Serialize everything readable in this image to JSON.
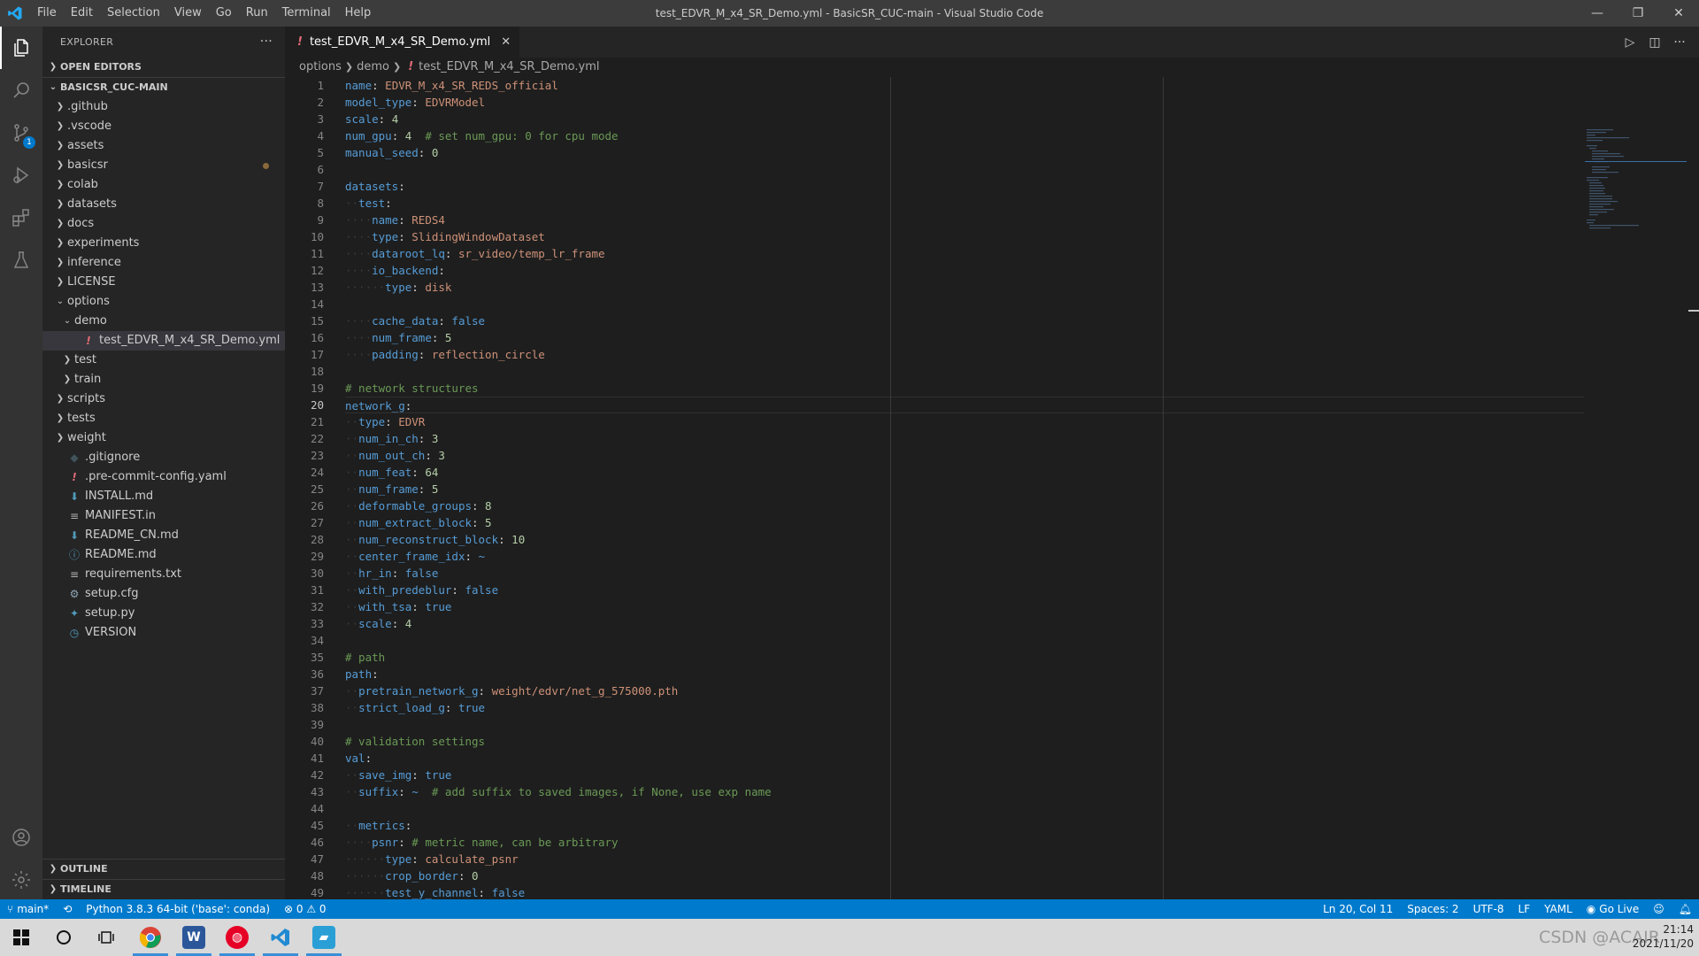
{
  "window": {
    "title": "test_EDVR_M_x4_SR_Demo.yml - BasicSR_CUC-main - Visual Studio Code",
    "controls": {
      "minimize": "—",
      "restore": "❐",
      "close": "✕"
    }
  },
  "menu": [
    "File",
    "Edit",
    "Selection",
    "View",
    "Go",
    "Run",
    "Terminal",
    "Help"
  ],
  "activity_bar": {
    "items": [
      "explorer-icon",
      "search-icon",
      "source-control-icon",
      "run-debug-icon",
      "extensions-icon",
      "testing-icon"
    ],
    "source_control_badge": "1",
    "bottom": [
      "accounts-icon",
      "settings-gear-icon"
    ]
  },
  "sidebar": {
    "header": "EXPLORER",
    "more": "···",
    "open_editors": "OPEN EDITORS",
    "root": "BASICSR_CUC-MAIN",
    "tree": [
      {
        "label": ".github",
        "type": "folder",
        "depth": 1
      },
      {
        "label": ".vscode",
        "type": "folder",
        "depth": 1
      },
      {
        "label": "assets",
        "type": "folder",
        "depth": 1
      },
      {
        "label": "basicsr",
        "type": "folder",
        "depth": 1,
        "modified": true
      },
      {
        "label": "colab",
        "type": "folder",
        "depth": 1
      },
      {
        "label": "datasets",
        "type": "folder",
        "depth": 1
      },
      {
        "label": "docs",
        "type": "folder",
        "depth": 1
      },
      {
        "label": "experiments",
        "type": "folder",
        "depth": 1
      },
      {
        "label": "inference",
        "type": "folder",
        "depth": 1
      },
      {
        "label": "LICENSE",
        "type": "folder",
        "depth": 1
      },
      {
        "label": "options",
        "type": "folder-open",
        "depth": 1
      },
      {
        "label": "demo",
        "type": "folder-open",
        "depth": 2
      },
      {
        "label": "test_EDVR_M_x4_SR_Demo.yml",
        "type": "yaml",
        "depth": 3,
        "selected": true
      },
      {
        "label": "test",
        "type": "folder",
        "depth": 2
      },
      {
        "label": "train",
        "type": "folder",
        "depth": 2
      },
      {
        "label": "scripts",
        "type": "folder",
        "depth": 1
      },
      {
        "label": "tests",
        "type": "folder",
        "depth": 1
      },
      {
        "label": "weight",
        "type": "folder",
        "depth": 1
      },
      {
        "label": ".gitignore",
        "type": "gitignore",
        "depth": 1
      },
      {
        "label": ".pre-commit-config.yaml",
        "type": "yaml",
        "depth": 1
      },
      {
        "label": "INSTALL.md",
        "type": "markdown",
        "depth": 1
      },
      {
        "label": "MANIFEST.in",
        "type": "text",
        "depth": 1
      },
      {
        "label": "README_CN.md",
        "type": "markdown",
        "depth": 1
      },
      {
        "label": "README.md",
        "type": "info",
        "depth": 1
      },
      {
        "label": "requirements.txt",
        "type": "text",
        "depth": 1
      },
      {
        "label": "setup.cfg",
        "type": "config",
        "depth": 1
      },
      {
        "label": "setup.py",
        "type": "python",
        "depth": 1
      },
      {
        "label": "VERSION",
        "type": "clock",
        "depth": 1
      }
    ],
    "outline": "OUTLINE",
    "timeline": "TIMELINE"
  },
  "editor": {
    "tab": {
      "label": "test_EDVR_M_x4_SR_Demo.yml",
      "icon": "!",
      "close": "✕"
    },
    "actions": [
      "run-icon",
      "split-editor-icon",
      "more-actions-icon"
    ],
    "breadcrumb": [
      "options",
      "demo",
      "test_EDVR_M_x4_SR_Demo.yml"
    ],
    "current_line": 20,
    "lines": [
      [
        [
          0,
          "k",
          "name"
        ],
        [
          0,
          "p",
          ":"
        ],
        [
          0,
          "s",
          " EDVR_M_x4_SR_REDS_official"
        ]
      ],
      [
        [
          0,
          "k",
          "model_type"
        ],
        [
          0,
          "p",
          ":"
        ],
        [
          0,
          "s",
          " EDVRModel"
        ]
      ],
      [
        [
          0,
          "k",
          "scale"
        ],
        [
          0,
          "p",
          ":"
        ],
        [
          0,
          "n",
          " 4"
        ]
      ],
      [
        [
          0,
          "k",
          "num_gpu"
        ],
        [
          0,
          "p",
          ":"
        ],
        [
          0,
          "n",
          " 4"
        ],
        [
          0,
          "c",
          "  # set num_gpu: 0 for cpu mode"
        ]
      ],
      [
        [
          0,
          "k",
          "manual_seed"
        ],
        [
          0,
          "p",
          ":"
        ],
        [
          0,
          "n",
          " 0"
        ]
      ],
      [],
      [
        [
          0,
          "k",
          "datasets"
        ],
        [
          0,
          "p",
          ":"
        ]
      ],
      [
        [
          1,
          "k",
          "test"
        ],
        [
          0,
          "p",
          ":"
        ]
      ],
      [
        [
          2,
          "k",
          "name"
        ],
        [
          0,
          "p",
          ":"
        ],
        [
          0,
          "s",
          " REDS4"
        ]
      ],
      [
        [
          2,
          "k",
          "type"
        ],
        [
          0,
          "p",
          ":"
        ],
        [
          0,
          "s",
          " SlidingWindowDataset"
        ]
      ],
      [
        [
          2,
          "k",
          "dataroot_lq"
        ],
        [
          0,
          "p",
          ":"
        ],
        [
          0,
          "s",
          " sr_video/temp_lr_frame"
        ]
      ],
      [
        [
          2,
          "k",
          "io_backend"
        ],
        [
          0,
          "p",
          ":"
        ]
      ],
      [
        [
          3,
          "k",
          "type"
        ],
        [
          0,
          "p",
          ":"
        ],
        [
          0,
          "s",
          " disk"
        ]
      ],
      [],
      [
        [
          2,
          "k",
          "cache_data"
        ],
        [
          0,
          "p",
          ":"
        ],
        [
          0,
          "b",
          " false"
        ]
      ],
      [
        [
          2,
          "k",
          "num_frame"
        ],
        [
          0,
          "p",
          ":"
        ],
        [
          0,
          "n",
          " 5"
        ]
      ],
      [
        [
          2,
          "k",
          "padding"
        ],
        [
          0,
          "p",
          ":"
        ],
        [
          0,
          "s",
          " reflection_circle"
        ]
      ],
      [],
      [
        [
          0,
          "c",
          "# network structures"
        ]
      ],
      [
        [
          0,
          "k",
          "network_g"
        ],
        [
          0,
          "p",
          ":"
        ]
      ],
      [
        [
          1,
          "k",
          "type"
        ],
        [
          0,
          "p",
          ":"
        ],
        [
          0,
          "s",
          " EDVR"
        ]
      ],
      [
        [
          1,
          "k",
          "num_in_ch"
        ],
        [
          0,
          "p",
          ":"
        ],
        [
          0,
          "n",
          " 3"
        ]
      ],
      [
        [
          1,
          "k",
          "num_out_ch"
        ],
        [
          0,
          "p",
          ":"
        ],
        [
          0,
          "n",
          " 3"
        ]
      ],
      [
        [
          1,
          "k",
          "num_feat"
        ],
        [
          0,
          "p",
          ":"
        ],
        [
          0,
          "n",
          " 64"
        ]
      ],
      [
        [
          1,
          "k",
          "num_frame"
        ],
        [
          0,
          "p",
          ":"
        ],
        [
          0,
          "n",
          " 5"
        ]
      ],
      [
        [
          1,
          "k",
          "deformable_groups"
        ],
        [
          0,
          "p",
          ":"
        ],
        [
          0,
          "n",
          " 8"
        ]
      ],
      [
        [
          1,
          "k",
          "num_extract_block"
        ],
        [
          0,
          "p",
          ":"
        ],
        [
          0,
          "n",
          " 5"
        ]
      ],
      [
        [
          1,
          "k",
          "num_reconstruct_block"
        ],
        [
          0,
          "p",
          ":"
        ],
        [
          0,
          "n",
          " 10"
        ]
      ],
      [
        [
          1,
          "k",
          "center_frame_idx"
        ],
        [
          0,
          "p",
          ":"
        ],
        [
          0,
          "b",
          " ~"
        ]
      ],
      [
        [
          1,
          "k",
          "hr_in"
        ],
        [
          0,
          "p",
          ":"
        ],
        [
          0,
          "b",
          " false"
        ]
      ],
      [
        [
          1,
          "k",
          "with_predeblur"
        ],
        [
          0,
          "p",
          ":"
        ],
        [
          0,
          "b",
          " false"
        ]
      ],
      [
        [
          1,
          "k",
          "with_tsa"
        ],
        [
          0,
          "p",
          ":"
        ],
        [
          0,
          "b",
          " true"
        ]
      ],
      [
        [
          1,
          "k",
          "scale"
        ],
        [
          0,
          "p",
          ":"
        ],
        [
          0,
          "n",
          " 4"
        ]
      ],
      [],
      [
        [
          0,
          "c",
          "# path"
        ]
      ],
      [
        [
          0,
          "k",
          "path"
        ],
        [
          0,
          "p",
          ":"
        ]
      ],
      [
        [
          1,
          "k",
          "pretrain_network_g"
        ],
        [
          0,
          "p",
          ":"
        ],
        [
          0,
          "s",
          " weight/edvr/net_g_575000.pth"
        ]
      ],
      [
        [
          1,
          "k",
          "strict_load_g"
        ],
        [
          0,
          "p",
          ":"
        ],
        [
          0,
          "b",
          " true"
        ]
      ],
      [],
      [
        [
          0,
          "c",
          "# validation settings"
        ]
      ],
      [
        [
          0,
          "k",
          "val"
        ],
        [
          0,
          "p",
          ":"
        ]
      ],
      [
        [
          1,
          "k",
          "save_img"
        ],
        [
          0,
          "p",
          ":"
        ],
        [
          0,
          "b",
          " true"
        ]
      ],
      [
        [
          1,
          "k",
          "suffix"
        ],
        [
          0,
          "p",
          ":"
        ],
        [
          0,
          "b",
          " ~"
        ],
        [
          0,
          "c",
          "  # add suffix to saved images, if None, use exp name"
        ]
      ],
      [],
      [
        [
          1,
          "k",
          "metrics"
        ],
        [
          0,
          "p",
          ":"
        ]
      ],
      [
        [
          2,
          "k",
          "psnr"
        ],
        [
          0,
          "p",
          ":"
        ],
        [
          0,
          "c",
          " # metric name, can be arbitrary"
        ]
      ],
      [
        [
          3,
          "k",
          "type"
        ],
        [
          0,
          "p",
          ":"
        ],
        [
          0,
          "s",
          " calculate_psnr"
        ]
      ],
      [
        [
          3,
          "k",
          "crop_border"
        ],
        [
          0,
          "p",
          ":"
        ],
        [
          0,
          "n",
          " 0"
        ]
      ],
      [
        [
          3,
          "k",
          "test_y_channel"
        ],
        [
          0,
          "p",
          ":"
        ],
        [
          0,
          "b",
          " false"
        ]
      ]
    ]
  },
  "status_bar": {
    "branch": "main*",
    "python": "Python 3.8.3 64-bit ('base': conda)",
    "problems": "⊗ 0 ⚠ 0",
    "position": "Ln 20, Col 11",
    "spaces": "Spaces: 2",
    "encoding": "UTF-8",
    "eol": "LF",
    "language": "YAML",
    "golive": "Go Live"
  },
  "taskbar": {
    "apps": [
      "windows-start-icon",
      "cortana-icon",
      "task-view-icon",
      "chrome-icon",
      "word-icon",
      "netease-music-icon",
      "vscode-icon",
      "app-icon"
    ],
    "word_letter": "W",
    "time": "21:14",
    "date": "2021/11/20",
    "watermark": "CSDN @ACAIR"
  },
  "colors": {
    "accent": "#007acc",
    "key": "#569cd6",
    "string": "#ce9178",
    "number": "#b5cea8",
    "comment": "#6a9955"
  }
}
